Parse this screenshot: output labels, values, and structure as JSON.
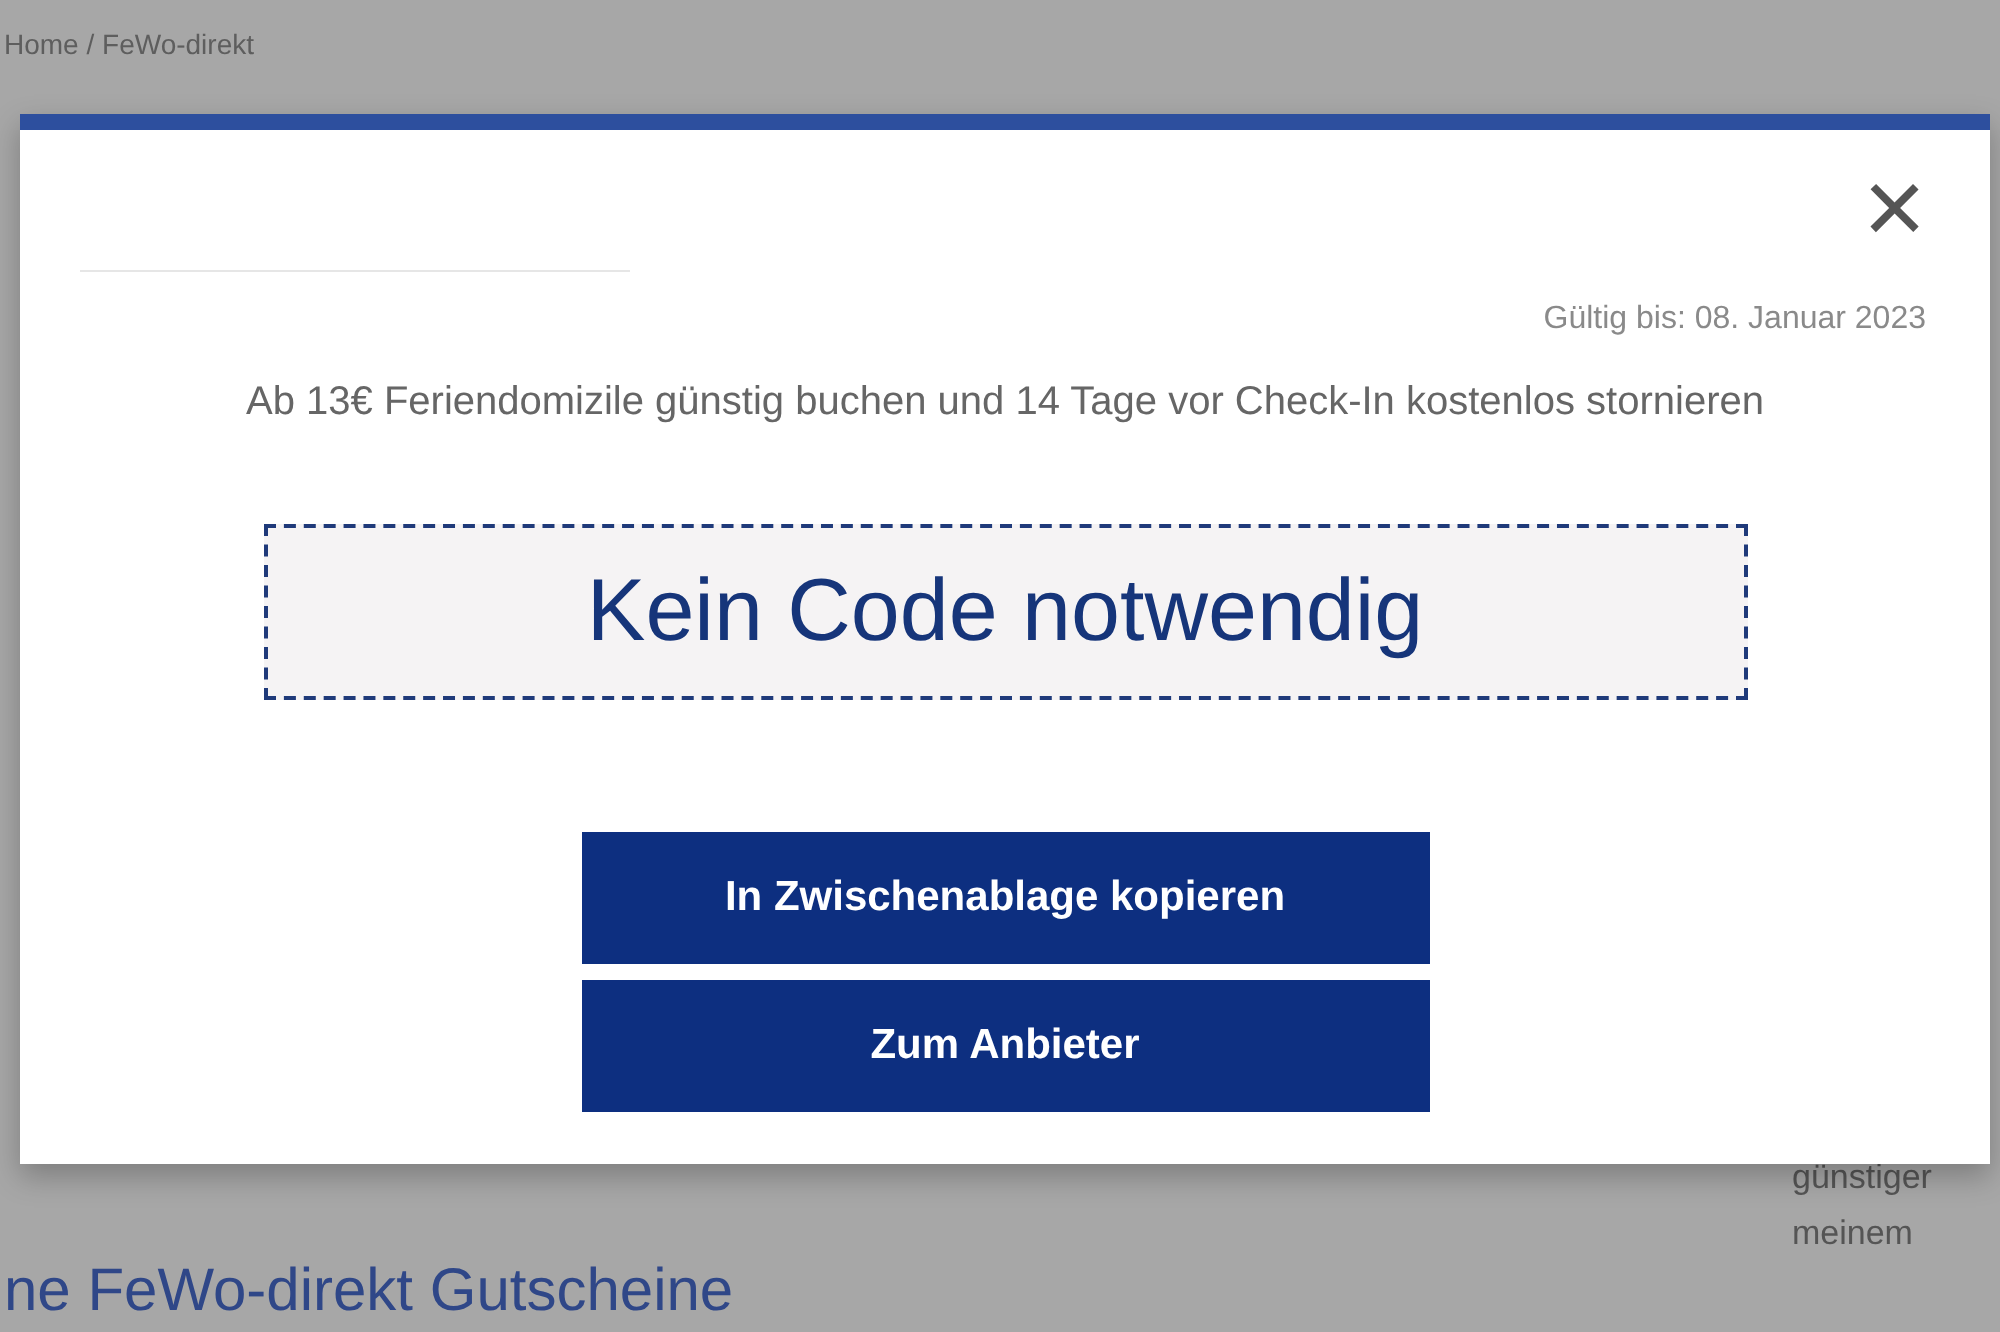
{
  "background": {
    "breadcrumb": "Home / FeWo-direkt",
    "heading": "ne FeWo-direkt Gutscheine",
    "side_text": [
      "günstiger",
      "meinem"
    ]
  },
  "modal": {
    "close": "×",
    "valid_until": "Gültig bis: 08. Januar 2023",
    "description": "Ab 13€ Feriendomizile günstig buchen und 14 Tage vor Check-In kostenlos stornieren",
    "code": "Kein Code notwendig",
    "buttons": [
      "In Zwischenablage kopieren",
      "Zum Anbieter"
    ]
  }
}
